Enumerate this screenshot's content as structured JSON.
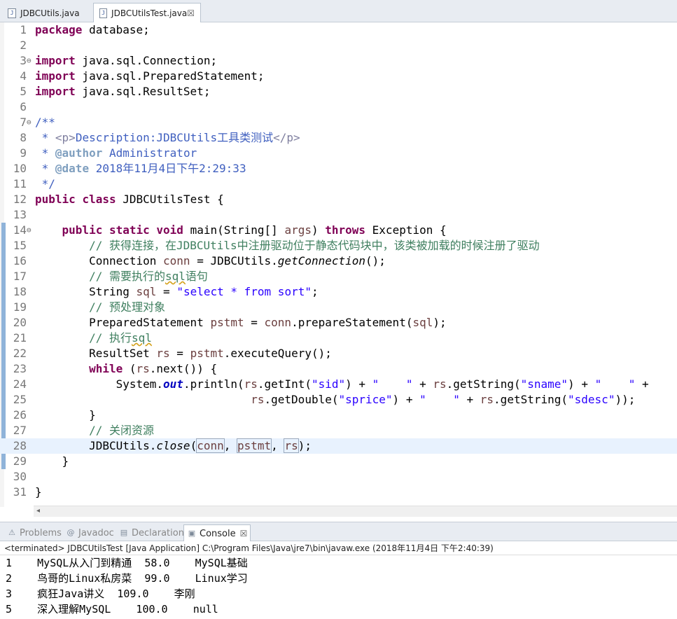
{
  "editor_tabs": [
    {
      "label": "JDBCUtils.java",
      "icon": "java-file-icon",
      "active": false
    },
    {
      "label": "JDBCUtilsTest.java",
      "icon": "java-file-icon",
      "active": true,
      "close": "☒"
    }
  ],
  "code_lines": [
    {
      "n": "1",
      "html": "<span class=\"kw\">package</span> database;"
    },
    {
      "n": "2",
      "html": ""
    },
    {
      "n": "3",
      "fold": "⊖",
      "html": "<span class=\"kw\">import</span> java.sql.Connection;"
    },
    {
      "n": "4",
      "html": "<span class=\"kw\">import</span> java.sql.PreparedStatement;"
    },
    {
      "n": "5",
      "html": "<span class=\"kw\">import</span> java.sql.ResultSet;"
    },
    {
      "n": "6",
      "html": ""
    },
    {
      "n": "7",
      "fold": "⊖",
      "html": "<span class=\"jd\">/**</span>"
    },
    {
      "n": "8",
      "html": "<span class=\"jd\"> * </span><span class=\"jdhtml\">&lt;p&gt;</span><span class=\"jd\">Description:JDBCUtils工具类测试</span><span class=\"jdhtml\">&lt;/p&gt;</span>"
    },
    {
      "n": "9",
      "html": "<span class=\"jd\"> * </span><span class=\"jdtag\">@author</span><span class=\"jd\"> Administrator</span>"
    },
    {
      "n": "10",
      "html": "<span class=\"jd\"> * </span><span class=\"jdtag\">@date</span><span class=\"jd\"> 2018年11月4日下午2:29:33</span>"
    },
    {
      "n": "11",
      "html": "<span class=\"jd\"> */</span>"
    },
    {
      "n": "12",
      "html": "<span class=\"kw\">public</span> <span class=\"kw\">class</span> JDBCUtilsTest {"
    },
    {
      "n": "13",
      "html": ""
    },
    {
      "n": "14",
      "fold": "⊖",
      "html": "    <span class=\"kw\">public</span> <span class=\"kw\">static</span> <span class=\"kw\">void</span> main(String[] <span class=\"var\">args</span>) <span class=\"kw\">throws</span> Exception {"
    },
    {
      "n": "15",
      "html": "        <span class=\"cmt\">// 获得连接，在JDBCUtils中注册驱动位于静态代码块中，该类被加载的时候注册了驱动</span>"
    },
    {
      "n": "16",
      "html": "        Connection <span class=\"var\">conn</span> = JDBCUtils.<span class=\"ital\">getConnection</span>();"
    },
    {
      "n": "17",
      "html": "        <span class=\"cmt\">// 需要执行的<span class=\"squig\">sql</span>语句</span>"
    },
    {
      "n": "18",
      "html": "        String <span class=\"var\">sql</span> = <span class=\"str\">\"select * from sort\"</span>;"
    },
    {
      "n": "19",
      "html": "        <span class=\"cmt\">// 预处理对象</span>"
    },
    {
      "n": "20",
      "html": "        PreparedStatement <span class=\"var\">pstmt</span> = <span class=\"var\">conn</span>.prepareStatement(<span class=\"var\">sql</span>);"
    },
    {
      "n": "21",
      "html": "        <span class=\"cmt\">// 执行<span class=\"squig\">sql</span></span>"
    },
    {
      "n": "22",
      "html": "        ResultSet <span class=\"var\">rs</span> = <span class=\"var\">pstmt</span>.executeQuery();"
    },
    {
      "n": "23",
      "html": "        <span class=\"kw\">while</span> (<span class=\"var\">rs</span>.next()) {"
    },
    {
      "n": "24",
      "html": "            System.<span class=\"fld\">out</span>.println(<span class=\"var\">rs</span>.getInt(<span class=\"str\">\"sid\"</span>) + <span class=\"str\">\"    \"</span> + <span class=\"var\">rs</span>.getString(<span class=\"str\">\"sname\"</span>) + <span class=\"str\">\"    \"</span> +"
    },
    {
      "n": "25",
      "html": "                                <span class=\"var\">rs</span>.getDouble(<span class=\"str\">\"sprice\"</span>) + <span class=\"str\">\"    \"</span> + <span class=\"var\">rs</span>.getString(<span class=\"str\">\"sdesc\"</span>));"
    },
    {
      "n": "26",
      "html": "        }"
    },
    {
      "n": "27",
      "html": "        <span class=\"cmt\">// 关闭资源</span>"
    },
    {
      "n": "28",
      "current": true,
      "html": "        JDBCUtils.<span class=\"ital\">close</span>(<span class=\"var boxed\">conn</span>, <span class=\"var boxed\">pstmt</span>, <span class=\"var boxed\">rs</span>);"
    },
    {
      "n": "29",
      "html": "    }"
    },
    {
      "n": "30",
      "html": ""
    },
    {
      "n": "31",
      "html": "}"
    }
  ],
  "panel_tabs": [
    {
      "label": "Problems",
      "icon": "problems-icon",
      "glyph": "⚠",
      "active": false
    },
    {
      "label": "Javadoc",
      "icon": "javadoc-icon",
      "glyph": "@",
      "active": false
    },
    {
      "label": "Declaration",
      "icon": "declaration-icon",
      "glyph": "▤",
      "active": false
    },
    {
      "label": "Console",
      "icon": "console-icon",
      "glyph": "▣",
      "active": true,
      "close": "☒"
    }
  ],
  "console_status": "<terminated> JDBCUtilsTest [Java Application] C:\\Program Files\\Java\\jre7\\bin\\javaw.exe (2018年11月4日 下午2:40:39)",
  "console_lines": [
    "1    MySQL从入门到精通  58.0    MySQL基础",
    "2    鸟哥的Linux私房菜  99.0    Linux学习",
    "3    疯狂Java讲义  109.0    李刚",
    "5    深入理解MySQL    100.0    null"
  ],
  "colors": {
    "keyword": "#7f0055",
    "string": "#2a00ff",
    "comment": "#3f7f5f",
    "javadoc": "#3f5fbf",
    "field": "#0000c0",
    "current_line": "#e8f2fe"
  }
}
